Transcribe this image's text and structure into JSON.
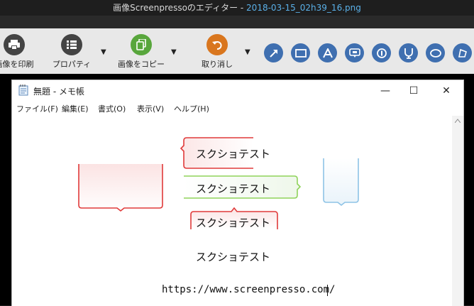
{
  "window": {
    "title_prefix": "画像Screenpressoのエディター  -  ",
    "file_name": "2018-03-15_02h39_16.png"
  },
  "toolbar": {
    "print_label": "画像を印刷",
    "properties_label": "プロパティ",
    "copy_label": "画像をコピー",
    "undo_label": "取り消し",
    "dropdown_glyph": "▼"
  },
  "notepad": {
    "title": "無題 - メモ帳",
    "minimize": "—",
    "maximize": "☐",
    "close": "✕",
    "menu": [
      "ファイル(F)",
      "編集(E)",
      "書式(O)",
      "表示(V)",
      "ヘルプ(H)"
    ],
    "lines": [
      "スクショテスト",
      "スクショテスト",
      "スクショテスト",
      "スクショテスト"
    ],
    "url": "https://www.screenpresso.com/"
  },
  "colors": {
    "red": "#e03a3a",
    "green": "#8fd35a",
    "blue": "#8ec3e6",
    "tool_blue": "#3f6fb0"
  }
}
